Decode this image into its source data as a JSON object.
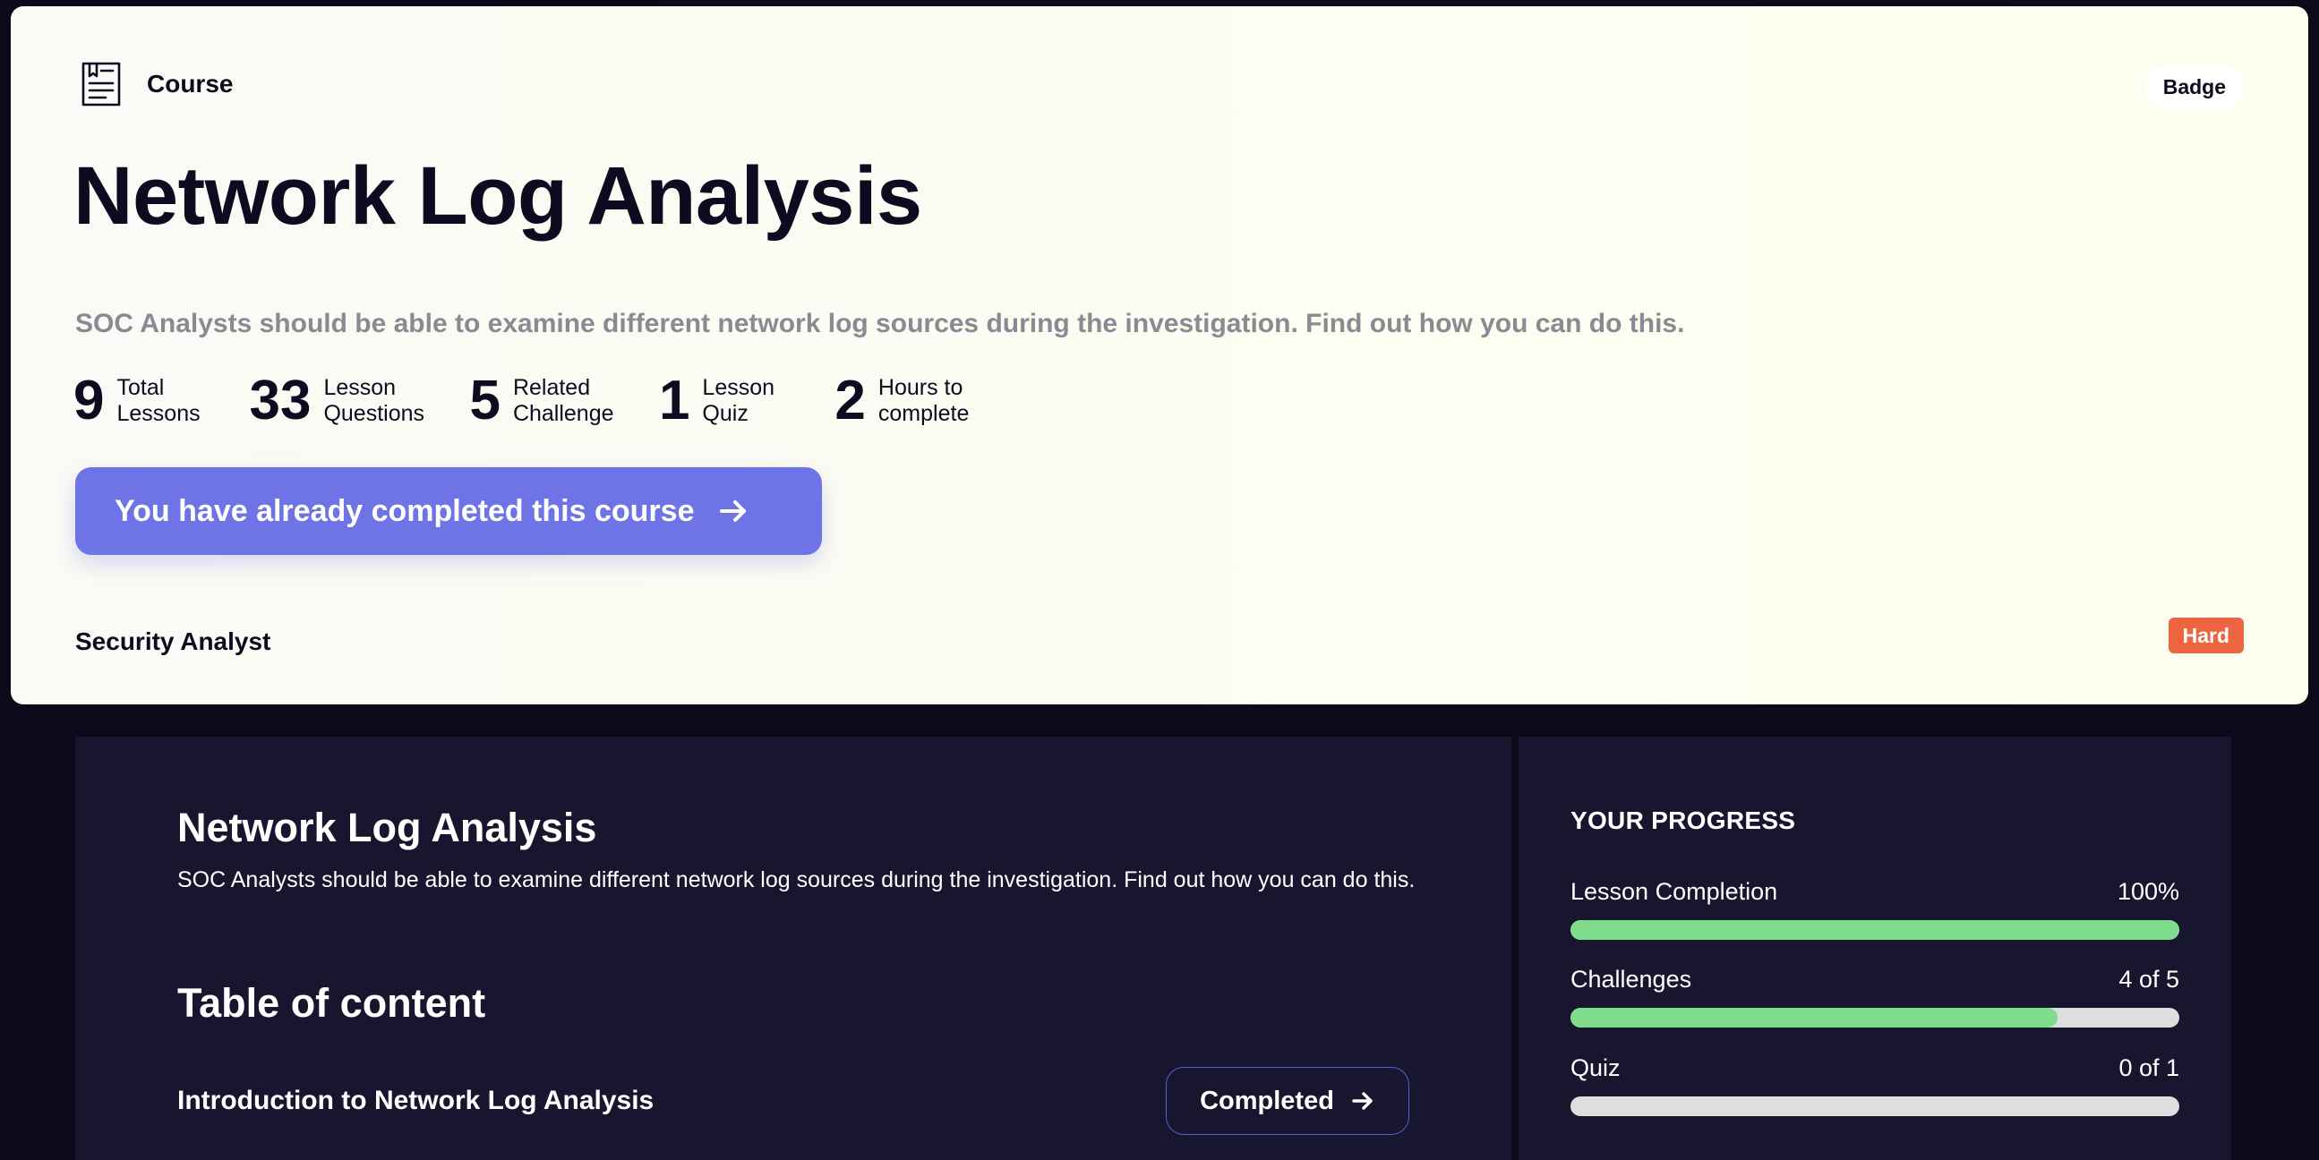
{
  "hero": {
    "kind_label": "Course",
    "badge_label": "Badge",
    "title": "Network Log Analysis",
    "description": "SOC Analysts should be able to examine different network log sources during the investigation. Find out how you can do this.",
    "stats": [
      {
        "value": "9",
        "label": "Total Lessons"
      },
      {
        "value": "33",
        "label": "Lesson Questions"
      },
      {
        "value": "5",
        "label": "Related Challenge"
      },
      {
        "value": "1",
        "label": "Lesson Quiz"
      },
      {
        "value": "2",
        "label": "Hours to complete"
      }
    ],
    "cta_label": "You have already completed this course",
    "path_label": "Security Analyst",
    "difficulty": "Hard"
  },
  "main": {
    "title": "Network Log Analysis",
    "description": "SOC Analysts should be able to examine different network log sources during the investigation. Find out how you can do this.",
    "toc_title": "Table of content",
    "toc_items": [
      {
        "label": "Introduction to Network Log Analysis",
        "status": "Completed"
      }
    ]
  },
  "progress": {
    "title": "YOUR PROGRESS",
    "rows": [
      {
        "label": "Lesson Completion",
        "value_text": "100%",
        "fraction": 1.0
      },
      {
        "label": "Challenges",
        "value_text": "4 of 5",
        "fraction": 0.8
      },
      {
        "label": "Quiz",
        "value_text": "0 of 1",
        "fraction": 0.0
      }
    ]
  },
  "colors": {
    "accent": "#6e74e6",
    "difficulty_hard": "#ec6540",
    "progress_fill": "#7fdc8a",
    "card_bg": "#18152f"
  },
  "icons": {
    "course": "book-icon",
    "cta": "arrow-right-icon"
  }
}
